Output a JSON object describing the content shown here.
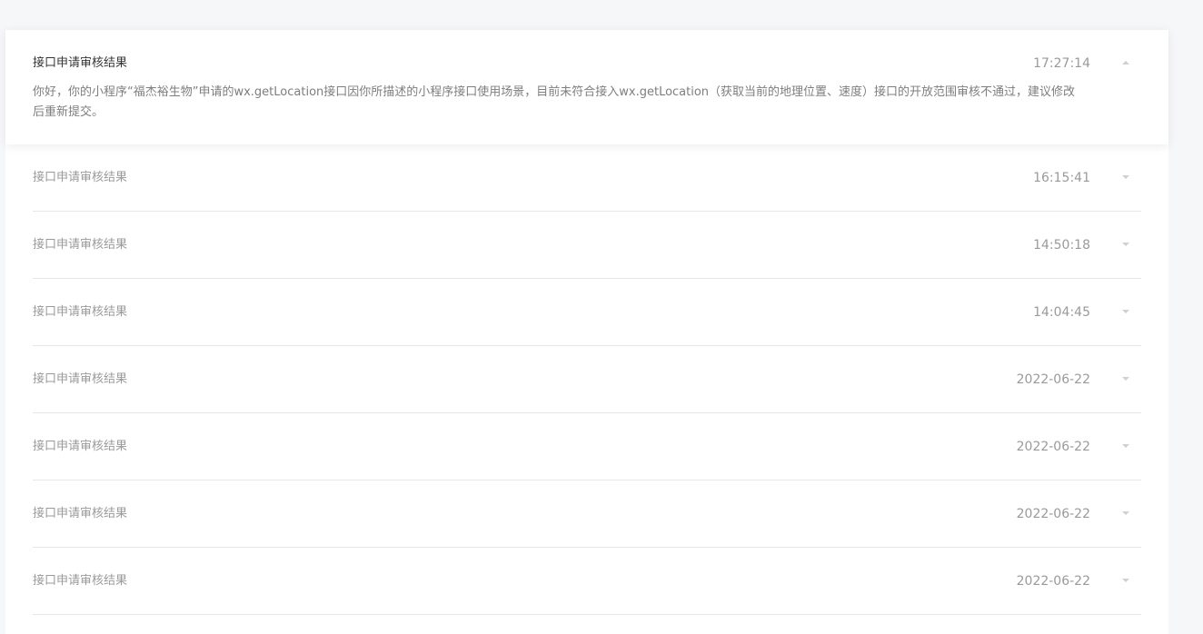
{
  "messages": [
    {
      "title": "接口申请审核结果",
      "time": "17:27:14",
      "body": "你好，你的小程序“福杰裕生物”申请的wx.getLocation接口因你所描述的小程序接口使用场景，目前未符合接入wx.getLocation（获取当前的地理位置、速度）接口的开放范围审核不通过，建议修改后重新提交。",
      "expanded": true
    },
    {
      "title": "接口申请审核结果",
      "time": "16:15:41"
    },
    {
      "title": "接口申请审核结果",
      "time": "14:50:18"
    },
    {
      "title": "接口申请审核结果",
      "time": "14:04:45"
    },
    {
      "title": "接口申请审核结果",
      "time": "2022-06-22"
    },
    {
      "title": "接口申请审核结果",
      "time": "2022-06-22"
    },
    {
      "title": "接口申请审核结果",
      "time": "2022-06-22"
    },
    {
      "title": "接口申请审核结果",
      "time": "2022-06-22"
    }
  ]
}
